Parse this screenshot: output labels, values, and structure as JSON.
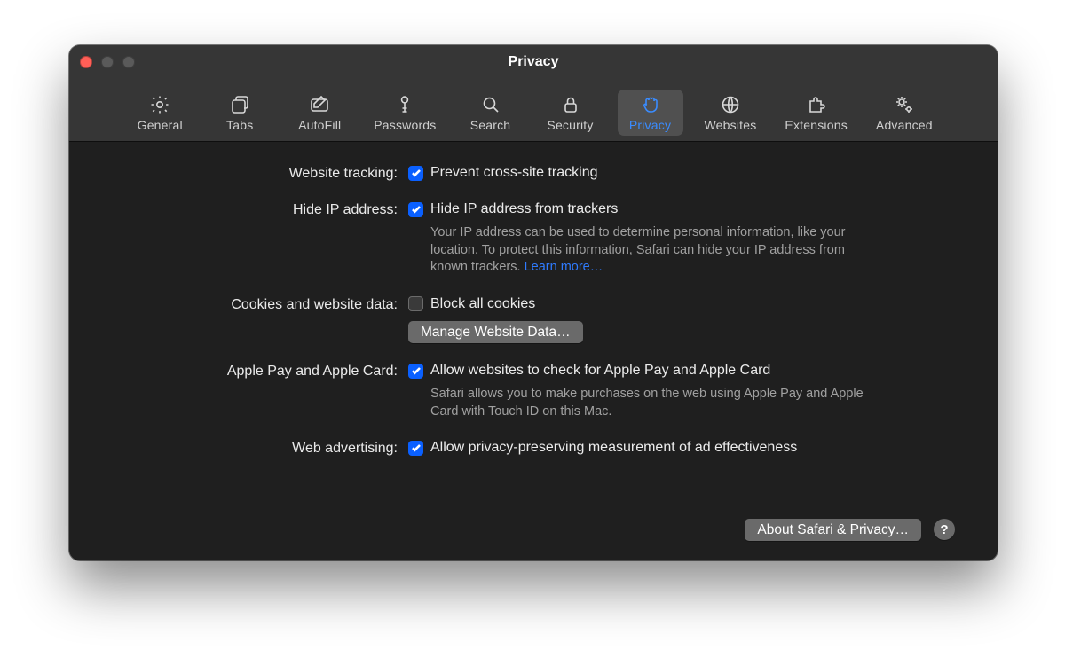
{
  "window": {
    "title": "Privacy"
  },
  "toolbar": {
    "items": [
      {
        "id": "general",
        "label": "General",
        "active": false
      },
      {
        "id": "tabs",
        "label": "Tabs",
        "active": false
      },
      {
        "id": "autofill",
        "label": "AutoFill",
        "active": false
      },
      {
        "id": "passwords",
        "label": "Passwords",
        "active": false
      },
      {
        "id": "search",
        "label": "Search",
        "active": false
      },
      {
        "id": "security",
        "label": "Security",
        "active": false
      },
      {
        "id": "privacy",
        "label": "Privacy",
        "active": true
      },
      {
        "id": "websites",
        "label": "Websites",
        "active": false
      },
      {
        "id": "extensions",
        "label": "Extensions",
        "active": false
      },
      {
        "id": "advanced",
        "label": "Advanced",
        "active": false
      }
    ]
  },
  "sections": {
    "website_tracking": {
      "label": "Website tracking:",
      "checkbox_label": "Prevent cross-site tracking",
      "checked": true
    },
    "hide_ip": {
      "label": "Hide IP address:",
      "checkbox_label": "Hide IP address from trackers",
      "checked": true,
      "description": "Your IP address can be used to determine personal information, like your location. To protect this information, Safari can hide your IP address from known trackers. ",
      "learn_more": "Learn more…"
    },
    "cookies": {
      "label": "Cookies and website data:",
      "checkbox_label": "Block all cookies",
      "checked": false,
      "button": "Manage Website Data…"
    },
    "apple_pay": {
      "label": "Apple Pay and Apple Card:",
      "checkbox_label": "Allow websites to check for Apple Pay and Apple Card",
      "checked": true,
      "description": "Safari allows you to make purchases on the web using Apple Pay and Apple Card with Touch ID on this Mac."
    },
    "web_adv": {
      "label": "Web advertising:",
      "checkbox_label": "Allow privacy-preserving measurement of ad effectiveness",
      "checked": true
    }
  },
  "footer": {
    "about_button": "About Safari & Privacy…",
    "help": "?"
  }
}
